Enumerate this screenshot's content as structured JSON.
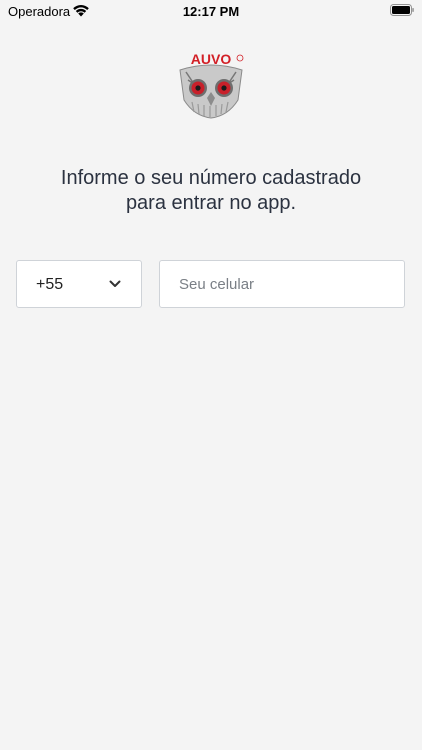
{
  "status_bar": {
    "carrier": "Operadora",
    "time": "12:17 PM"
  },
  "logo": {
    "brand_text": "AUVO",
    "brand_color": "#d21f26"
  },
  "instruction": {
    "line1": "Informe o seu número cadastrado",
    "line2": "para entrar no app."
  },
  "country_select": {
    "value": "+55"
  },
  "phone_input": {
    "placeholder": "Seu celular",
    "value": ""
  }
}
